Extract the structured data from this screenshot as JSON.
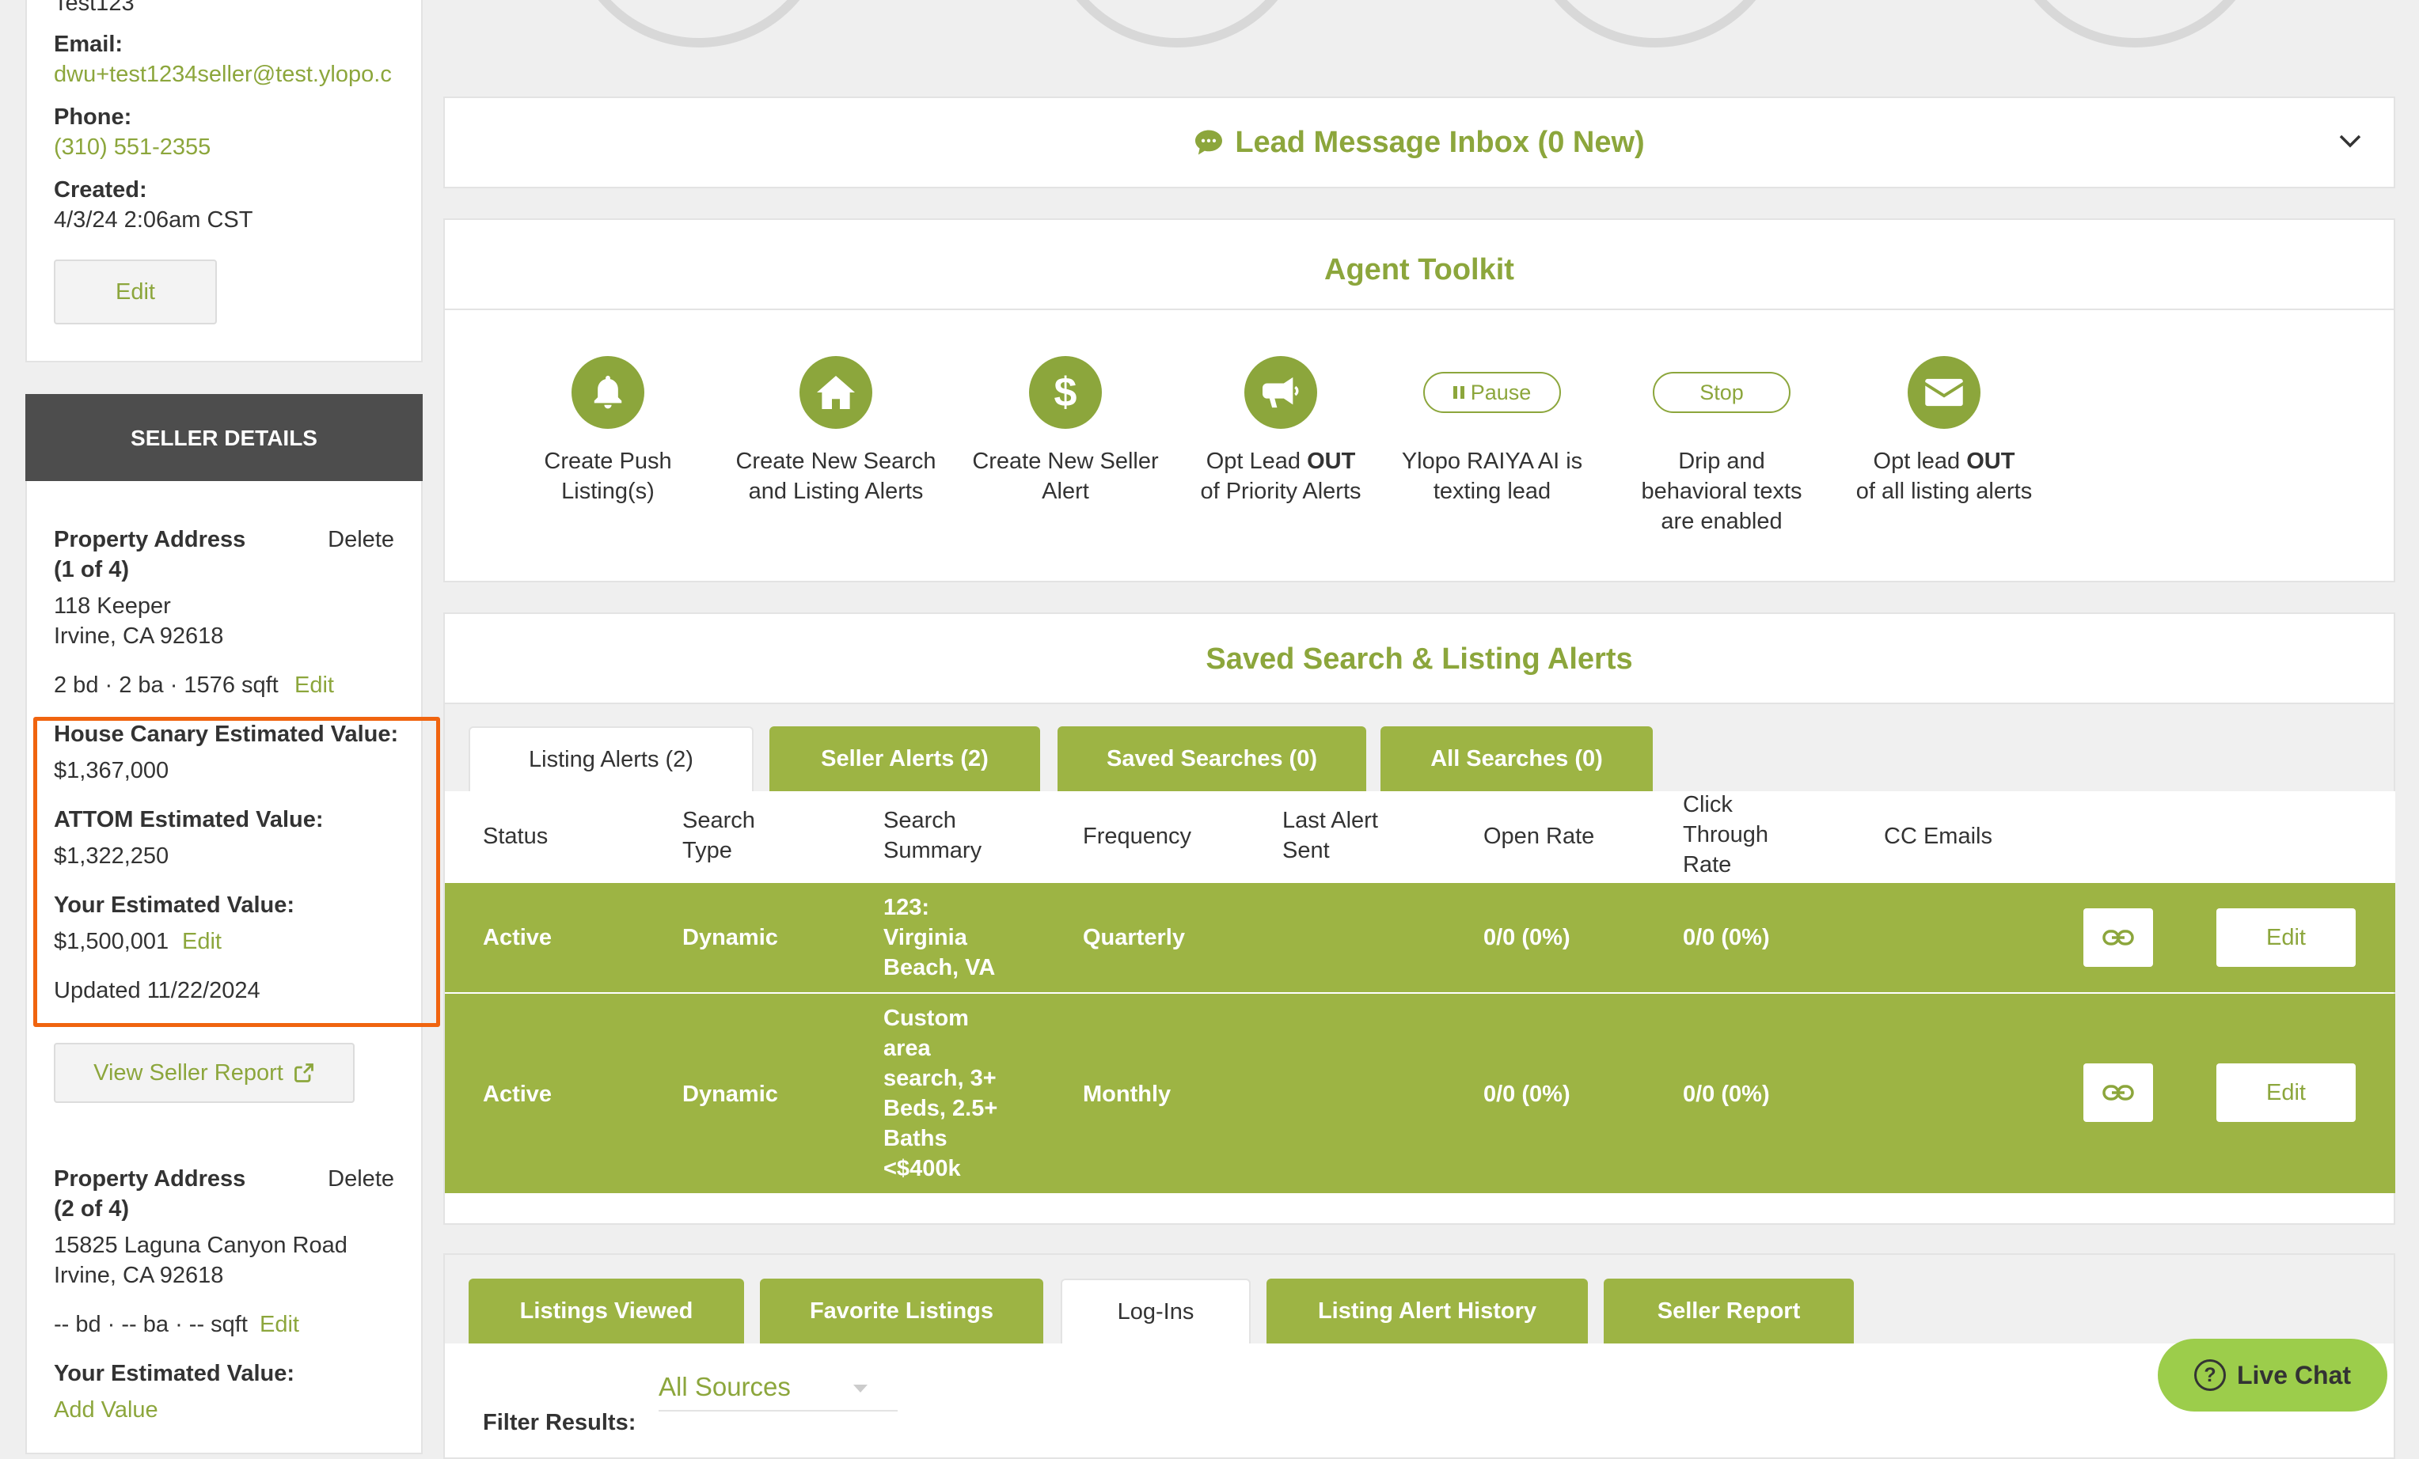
{
  "contact": {
    "name_partial": "Test123",
    "email_label": "Email:",
    "email": "dwu+test1234seller@test.ylopo.c",
    "phone_label": "Phone:",
    "phone": "(310) 551-2355",
    "created_label": "Created:",
    "created": "4/3/24 2:06am CST",
    "edit_label": "Edit"
  },
  "seller_details": {
    "header": "SELLER DETAILS",
    "property1": {
      "label": "Property Address",
      "count": "(1 of 4)",
      "delete_label": "Delete",
      "street": "118 Keeper",
      "city": "Irvine, CA 92618",
      "specs": "2 bd · 2 ba · 1576 sqft",
      "edit_label": "Edit",
      "hc_label": "House Canary Estimated Value:",
      "hc_value": "$1,367,000",
      "attom_label": "ATTOM Estimated Value:",
      "attom_value": "$1,322,250",
      "your_label": "Your Estimated Value:",
      "your_value": "$1,500,001",
      "your_edit_label": "Edit",
      "updated": "Updated 11/22/2024",
      "report_label": "View Seller Report"
    },
    "property2": {
      "label": "Property Address",
      "count": "(2 of 4)",
      "delete_label": "Delete",
      "street": "15825 Laguna Canyon Road",
      "city": "Irvine, CA 92618",
      "specs": "-- bd · -- ba · -- sqft",
      "edit_label": "Edit",
      "your_label": "Your Estimated Value:",
      "add_value_label": "Add Value"
    }
  },
  "inbox": {
    "title": "Lead Message Inbox (0 New)"
  },
  "toolkit": {
    "title": "Agent Toolkit",
    "items": [
      {
        "icon": "bell-icon",
        "line1": "Create Push",
        "line2": "Listing(s)"
      },
      {
        "icon": "home-icon",
        "line1": "Create New Search",
        "line2": "and Listing Alerts"
      },
      {
        "icon": "dollar-icon",
        "line1": "Create New Seller",
        "line2": "Alert"
      },
      {
        "icon": "megaphone-icon",
        "line1_pre": "Opt Lead ",
        "line1_bold": "OUT",
        "line2": "of Priority Alerts"
      },
      {
        "pill": "Pause",
        "line1": "Ylopo RAIYA AI is",
        "line2": "texting lead"
      },
      {
        "pill": "Stop",
        "line1": "Drip and",
        "line2": "behavioral texts",
        "line3": "are enabled"
      },
      {
        "icon": "envelope-icon",
        "line1_pre": "Opt lead ",
        "line1_bold": "OUT",
        "line2": "of all listing alerts"
      }
    ]
  },
  "saved_search": {
    "title": "Saved Search & Listing Alerts",
    "tabs": [
      "Listing Alerts (2)",
      "Seller Alerts (2)",
      "Saved Searches (0)",
      "All Searches (0)"
    ],
    "active_tab": 0,
    "columns": [
      {
        "l1": "Status"
      },
      {
        "l1": "Search",
        "l2": "Type"
      },
      {
        "l1": "Search",
        "l2": "Summary"
      },
      {
        "l1": "Frequency"
      },
      {
        "l1": "Last Alert",
        "l2": "Sent"
      },
      {
        "l1": "Open Rate"
      },
      {
        "l1": "Click",
        "l2": "Through",
        "l3": "Rate"
      },
      {
        "l1": "CC Emails"
      }
    ],
    "rows": [
      {
        "status": "Active",
        "type": "Dynamic",
        "summary": [
          "123:",
          "Virginia",
          "Beach, VA"
        ],
        "frequency": "Quarterly",
        "last_sent": "",
        "open_rate": "0/0 (0%)",
        "ctr": "0/0 (0%)",
        "edit_label": "Edit"
      },
      {
        "status": "Active",
        "type": "Dynamic",
        "summary": [
          "Custom",
          "area",
          "search, 3+",
          "Beds, 2.5+",
          "Baths",
          "<$400k"
        ],
        "frequency": "Monthly",
        "last_sent": "",
        "open_rate": "0/0 (0%)",
        "ctr": "0/0 (0%)",
        "edit_label": "Edit"
      }
    ]
  },
  "activity": {
    "tabs": [
      "Listings Viewed",
      "Favorite Listings",
      "Log-Ins",
      "Listing Alert History",
      "Seller Report"
    ],
    "active_tab": 2,
    "filter_label": "Filter Results:",
    "filter_value": "All Sources"
  },
  "live_chat": {
    "label": "Live Chat"
  },
  "colors": {
    "brand_green": "#8ca63c",
    "row_green": "#9db444",
    "delete_red": "#d9443a",
    "highlight_orange": "#f0640f",
    "header_dark": "#4d4d4d",
    "chat_green": "#9ccd4b"
  }
}
